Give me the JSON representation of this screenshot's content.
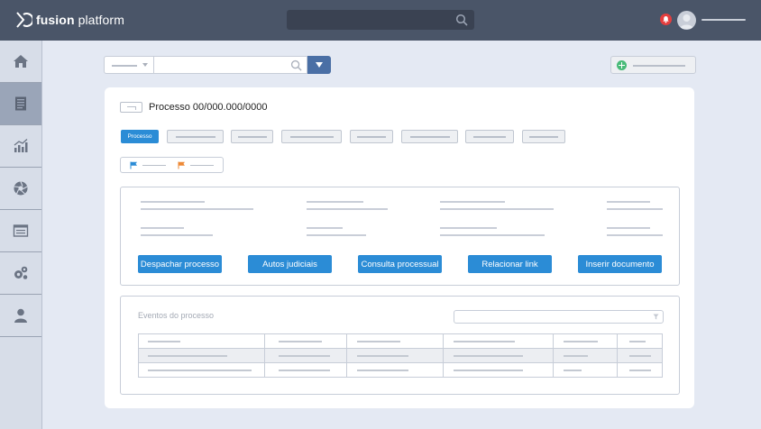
{
  "app": {
    "brand_bold": "fusion",
    "brand_light": " platform"
  },
  "colors": {
    "header": "#4a5568",
    "accent": "#2b8cd6",
    "notification": "#e53e3e",
    "add": "#48bb78"
  },
  "icons": {
    "logo": "fusion-logo-icon",
    "search": "search-icon",
    "bell": "bell-icon",
    "avatar": "user-avatar-icon",
    "sidebar": [
      "home-icon",
      "document-icon",
      "chart-icon",
      "aperture-icon",
      "list-icon",
      "gears-icon",
      "user-icon"
    ],
    "flags": [
      "blue-flag-icon",
      "orange-flag-icon"
    ],
    "filter": "funnel-icon"
  },
  "process": {
    "title": "Processo 00/000.000/0000",
    "active_tab": "Processo"
  },
  "actions": [
    "Despachar processo",
    "Autos judiciais",
    "Consulta processual",
    "Relacionar link",
    "Inserir documento"
  ],
  "events": {
    "title": "Eventos do processo"
  }
}
